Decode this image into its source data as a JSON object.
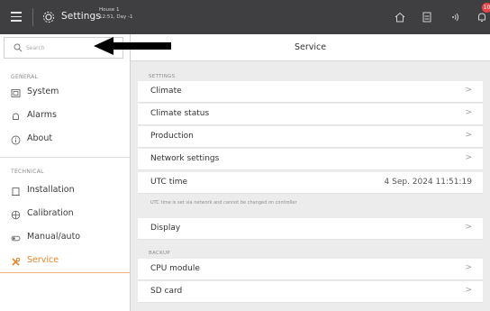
{
  "topbar": {
    "title": "Settings",
    "house_line1": "House 1",
    "house_line2": "12:51, Day -1",
    "notification_count": "10",
    "icons": [
      "menu-icon",
      "gear-icon",
      "home-icon",
      "device-icon",
      "wifi-icon",
      "bell-icon"
    ]
  },
  "sidebar": {
    "search_placeholder": "Search",
    "general_label": "GENERAL",
    "technical_label": "TECHNICAL",
    "items": [
      {
        "label": "System",
        "icon": "system-icon"
      },
      {
        "label": "Alarms",
        "icon": "alarm-icon"
      },
      {
        "label": "About",
        "icon": "info-icon"
      },
      {
        "label": "Installation",
        "icon": "installation-icon"
      },
      {
        "label": "Calibration",
        "icon": "calibration-icon"
      },
      {
        "label": "Manual/auto",
        "icon": "manual-auto-icon"
      },
      {
        "label": "Service",
        "icon": "service-icon",
        "active": true
      }
    ]
  },
  "main": {
    "title": "Service",
    "settings_label": "SETTINGS",
    "backup_label": "BACKUP",
    "rows": [
      {
        "label": "Climate",
        "chevron": ">"
      },
      {
        "label": "Climate status",
        "chevron": ">"
      },
      {
        "label": "Production",
        "chevron": ">"
      },
      {
        "label": "Network settings",
        "chevron": ">"
      },
      {
        "label": "UTC time",
        "value": "4 Sep. 2024 11:51:19"
      }
    ],
    "utc_note": "UTC time is set via network and cannot be changed on controller",
    "display": {
      "label": "Display",
      "chevron": ">"
    },
    "backup_rows": [
      {
        "label": "CPU module",
        "chevron": ">"
      },
      {
        "label": "SD card",
        "chevron": ">"
      }
    ]
  },
  "colors": {
    "topbar": "#3f3f41",
    "accent": "#e8842a",
    "badge": "#e8454a",
    "background": "#ececec"
  }
}
